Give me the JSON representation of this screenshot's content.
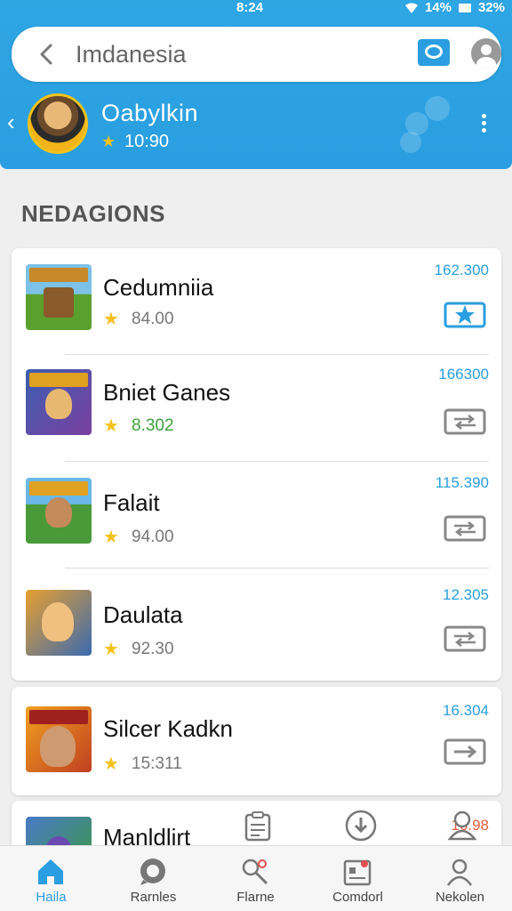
{
  "status_bar": {
    "time": "8:24",
    "battery_pct": "14%",
    "extra": "32%"
  },
  "search": {
    "value": "Imdanesia"
  },
  "profile": {
    "name": "Oabylkin",
    "rating": "10:90"
  },
  "section": {
    "title": "NEDAGIONS"
  },
  "games": [
    {
      "title": "Cedumniia",
      "rating": "84.00",
      "price": "162.300",
      "action_icon": "share-star-icon",
      "rating_color": "#777777"
    },
    {
      "title": "Bniet Ganes",
      "rating": "8.302",
      "price": "166300",
      "action_icon": "swap-icon",
      "rating_color": "#3aa33a"
    },
    {
      "title": "Falait",
      "rating": "94.00",
      "price": "115.390",
      "action_icon": "swap-icon",
      "rating_color": "#777777"
    },
    {
      "title": "Daulata",
      "rating": "92.30",
      "price": "12.305",
      "action_icon": "swap-icon",
      "rating_color": "#777777"
    },
    {
      "title": "Silcer Kadkn",
      "rating": "15:311",
      "price": "16.304",
      "action_icon": "swap-icon",
      "rating_color": "#777777"
    },
    {
      "title": "Manldlirt",
      "price": "16.98"
    }
  ],
  "nav": [
    {
      "label": "Haila",
      "icon": "home-icon",
      "active": true
    },
    {
      "label": "Rarnles",
      "icon": "chat-icon",
      "active": false
    },
    {
      "label": "Flarne",
      "icon": "search-person-icon",
      "active": false
    },
    {
      "label": "Comdorl",
      "icon": "calendar-icon",
      "active": false
    },
    {
      "label": "Nekolen",
      "icon": "person-icon",
      "active": false
    }
  ],
  "colors": {
    "accent": "#2a9ee0",
    "star": "#f4c21c"
  }
}
